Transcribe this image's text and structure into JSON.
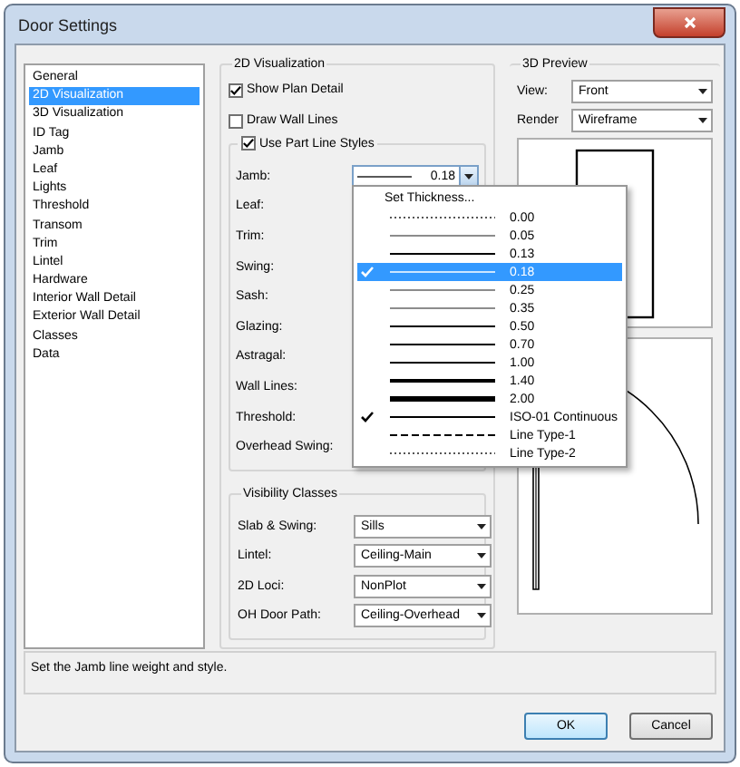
{
  "window": {
    "title": "Door Settings"
  },
  "sidebar": {
    "items": [
      {
        "label": "General",
        "selected": false
      },
      {
        "label": "2D Visualization",
        "selected": true
      },
      {
        "label": "3D Visualization",
        "selected": false
      },
      {
        "label": "ID Tag",
        "selected": false
      },
      {
        "label": "Jamb",
        "selected": false
      },
      {
        "label": "Leaf",
        "selected": false
      },
      {
        "label": "Lights",
        "selected": false
      },
      {
        "label": "Threshold",
        "selected": false
      },
      {
        "label": "Transom",
        "selected": false
      },
      {
        "label": "Trim",
        "selected": false
      },
      {
        "label": "Lintel",
        "selected": false
      },
      {
        "label": "Hardware",
        "selected": false
      },
      {
        "label": "Interior Wall Detail",
        "selected": false
      },
      {
        "label": "Exterior Wall Detail",
        "selected": false
      },
      {
        "label": "Classes",
        "selected": false
      },
      {
        "label": "Data",
        "selected": false
      }
    ]
  },
  "visualization": {
    "title": "2D Visualization",
    "options": [
      {
        "label": "Show Plan Detail",
        "checked": true
      },
      {
        "label": "Draw Wall Lines",
        "checked": false
      }
    ],
    "part_line_styles": {
      "label": "Use Part Line Styles",
      "checked": true,
      "rows": [
        {
          "label": "Jamb:",
          "value": "0.18"
        },
        {
          "label": "Leaf:"
        },
        {
          "label": "Trim:"
        },
        {
          "label": "Swing:"
        },
        {
          "label": "Sash:"
        },
        {
          "label": "Glazing:"
        },
        {
          "label": "Astragal:"
        },
        {
          "label": "Wall Lines:"
        },
        {
          "label": "Threshold:"
        },
        {
          "label": "Overhead Swing:"
        }
      ]
    },
    "line_menu": [
      {
        "kind": "action",
        "label": "Set Thickness..."
      },
      {
        "kind": "dotted",
        "label": "0.00",
        "selected": false,
        "checked": false
      },
      {
        "kind": "hair",
        "label": "0.05",
        "selected": false,
        "checked": false
      },
      {
        "kind": "medium",
        "label": "0.13",
        "selected": false,
        "checked": false
      },
      {
        "kind": "thin",
        "label": "0.18",
        "selected": true,
        "checked": true
      },
      {
        "kind": "hair",
        "label": "0.25",
        "selected": false,
        "checked": false
      },
      {
        "kind": "hair",
        "label": "0.35",
        "selected": false,
        "checked": false
      },
      {
        "kind": "medium",
        "label": "0.50",
        "selected": false,
        "checked": false
      },
      {
        "kind": "medium",
        "label": "0.70",
        "selected": false,
        "checked": false
      },
      {
        "kind": "medium",
        "label": "1.00",
        "selected": false,
        "checked": false
      },
      {
        "kind": "thick",
        "label": "1.40",
        "selected": false,
        "checked": false
      },
      {
        "kind": "heavy",
        "label": "2.00",
        "selected": false,
        "checked": false
      },
      {
        "kind": "medium",
        "label": "ISO-01 Continuous",
        "selected": false,
        "checked": true
      },
      {
        "kind": "dashed",
        "label": "Line Type-1",
        "selected": false,
        "checked": false
      },
      {
        "kind": "dotted",
        "label": "Line Type-2",
        "selected": false,
        "checked": false
      }
    ]
  },
  "visibility_classes": {
    "title": "Visibility Classes",
    "rows": [
      {
        "label": "Slab & Swing:",
        "value": "Sills"
      },
      {
        "label": "Lintel:",
        "value": "Ceiling-Main"
      },
      {
        "label": "2D Loci:",
        "value": "NonPlot"
      },
      {
        "label": "OH Door Path:",
        "value": "Ceiling-Overhead"
      }
    ]
  },
  "preview": {
    "title": "3D Preview",
    "fields": [
      {
        "label": "View:",
        "value": "Front"
      },
      {
        "label": "Render",
        "value": "Wireframe"
      }
    ]
  },
  "status": {
    "text": "Set the Jamb line weight and style."
  },
  "buttons": [
    {
      "label": "OK",
      "kind": "default"
    },
    {
      "label": "Cancel",
      "kind": "normal"
    }
  ]
}
